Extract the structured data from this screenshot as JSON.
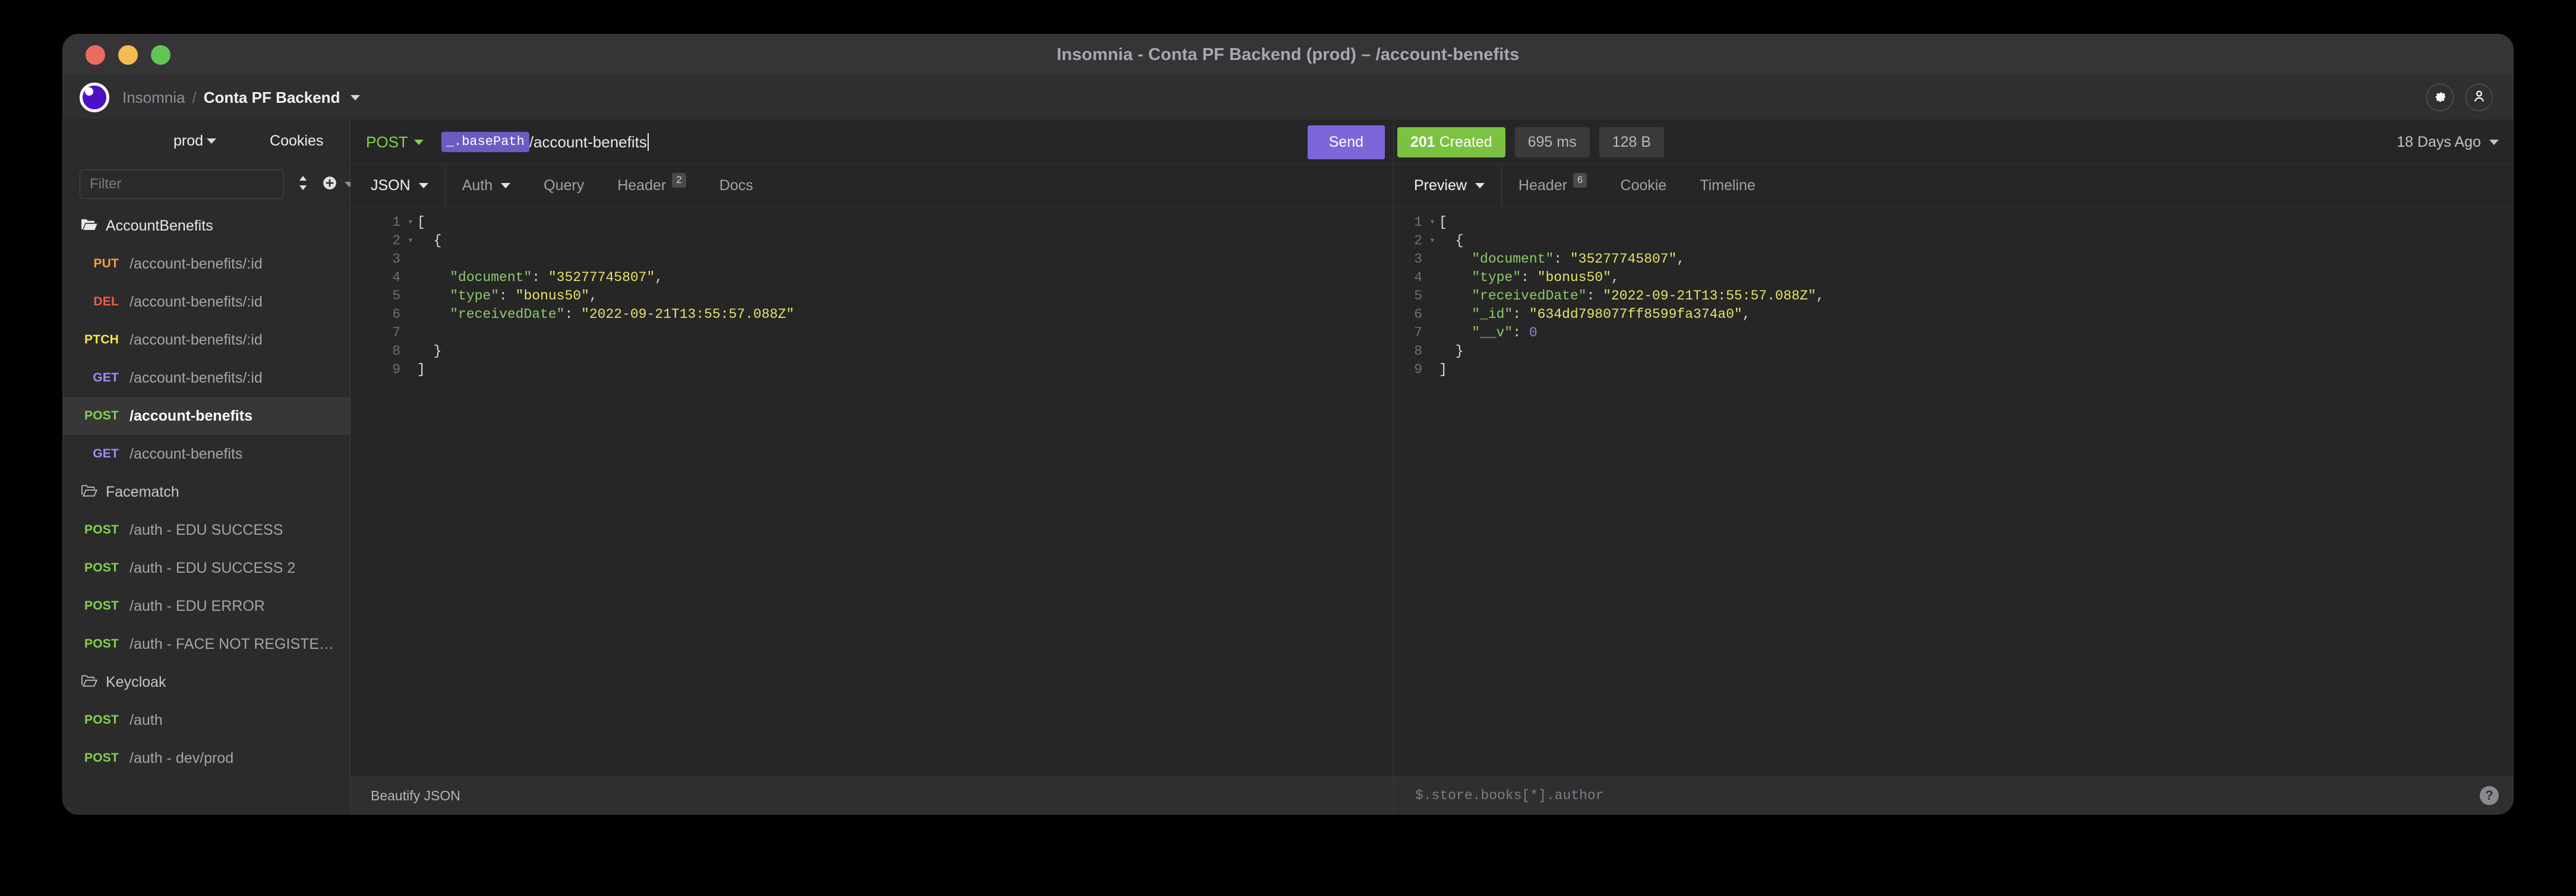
{
  "window": {
    "title": "Insomnia - Conta PF Backend (prod) – /account-benefits",
    "traffic_lights": [
      "close-button",
      "minimize-button",
      "maximize-button"
    ]
  },
  "header": {
    "logo_icon": "insomnia-logo-icon",
    "app_name": "Insomnia",
    "separator": "/",
    "workspace": "Conta PF Backend",
    "workspace_caret_icon": "chevron-down-icon",
    "settings_icon": "gear-icon",
    "account_icon": "user-icon"
  },
  "sidebar": {
    "environment": "prod",
    "environment_caret_icon": "chevron-down-icon",
    "cookies_label": "Cookies",
    "filter_placeholder": "Filter",
    "filter_value": "",
    "sort_icon": "sort-updown-icon",
    "add_icon": "plus-circle-icon",
    "add_caret_icon": "chevron-down-icon",
    "groups": [
      {
        "name": "AccountBenefits",
        "folder_icon": "folder-open-filled-icon",
        "expanded": true,
        "requests": [
          {
            "method": "PUT",
            "name": "/account-benefits/:id",
            "active": false
          },
          {
            "method": "DEL",
            "name": "/account-benefits/:id",
            "active": false
          },
          {
            "method": "PTCH",
            "name": "/account-benefits/:id",
            "active": false
          },
          {
            "method": "GET",
            "name": "/account-benefits/:id",
            "active": false
          },
          {
            "method": "POST",
            "name": "/account-benefits",
            "active": true
          },
          {
            "method": "GET",
            "name": "/account-benefits",
            "active": false
          }
        ]
      },
      {
        "name": "Facematch",
        "folder_icon": "folder-open-outline-icon",
        "expanded": true,
        "requests": [
          {
            "method": "POST",
            "name": "/auth - EDU SUCCESS",
            "active": false
          },
          {
            "method": "POST",
            "name": "/auth - EDU SUCCESS 2",
            "active": false
          },
          {
            "method": "POST",
            "name": "/auth - EDU ERROR",
            "active": false
          },
          {
            "method": "POST",
            "name": "/auth - FACE NOT REGISTER...",
            "active": false
          }
        ]
      },
      {
        "name": "Keycloak",
        "folder_icon": "folder-open-outline-icon",
        "expanded": true,
        "requests": [
          {
            "method": "POST",
            "name": "/auth",
            "active": false
          },
          {
            "method": "POST",
            "name": "/auth - dev/prod",
            "active": false
          }
        ]
      }
    ]
  },
  "request": {
    "method": "POST",
    "method_caret_icon": "chevron-down-icon",
    "url_template_tag": "_.basePath",
    "url_path": "/account-benefits",
    "send_label": "Send",
    "tabs": [
      {
        "label": "JSON",
        "has_caret": true,
        "badge": null,
        "active": true
      },
      {
        "label": "Auth",
        "has_caret": true,
        "badge": null,
        "active": false
      },
      {
        "label": "Query",
        "has_caret": false,
        "badge": null,
        "active": false
      },
      {
        "label": "Header",
        "has_caret": false,
        "badge": "2",
        "active": false
      },
      {
        "label": "Docs",
        "has_caret": false,
        "badge": null,
        "active": false
      }
    ],
    "body_lines": [
      {
        "n": "1",
        "fold": true,
        "text": "["
      },
      {
        "n": "2",
        "fold": true,
        "text": "  {"
      },
      {
        "n": "3",
        "fold": false,
        "text": ""
      },
      {
        "n": "4",
        "fold": false,
        "key": "\"document\"",
        "sep": ": ",
        "val": "\"35277745807\"",
        "tail": ",",
        "indent": "    "
      },
      {
        "n": "5",
        "fold": false,
        "key": "\"type\"",
        "sep": ": ",
        "val": "\"bonus50\"",
        "tail": ",",
        "indent": "    "
      },
      {
        "n": "6",
        "fold": false,
        "key": "\"receivedDate\"",
        "sep": ": ",
        "val": "\"2022-09-21T13:55:57.088Z\"",
        "tail": "",
        "indent": "    "
      },
      {
        "n": "7",
        "fold": false,
        "text": ""
      },
      {
        "n": "8",
        "fold": false,
        "text": "  }"
      },
      {
        "n": "9",
        "fold": false,
        "text": "]"
      }
    ],
    "footer_label": "Beautify JSON"
  },
  "response": {
    "status_code": "201",
    "status_text": "Created",
    "time": "695 ms",
    "size": "128 B",
    "history_label": "18 Days Ago",
    "history_caret_icon": "chevron-down-icon",
    "tabs": [
      {
        "label": "Preview",
        "has_caret": true,
        "badge": null,
        "active": true
      },
      {
        "label": "Header",
        "has_caret": false,
        "badge": "6",
        "active": false
      },
      {
        "label": "Cookie",
        "has_caret": false,
        "badge": null,
        "active": false
      },
      {
        "label": "Timeline",
        "has_caret": false,
        "badge": null,
        "active": false
      }
    ],
    "body_lines": [
      {
        "n": "1",
        "fold": true,
        "text": "["
      },
      {
        "n": "2",
        "fold": true,
        "text": "  {"
      },
      {
        "n": "3",
        "fold": false,
        "key": "\"document\"",
        "sep": ": ",
        "val": "\"35277745807\"",
        "tail": ",",
        "indent": "    "
      },
      {
        "n": "4",
        "fold": false,
        "key": "\"type\"",
        "sep": ": ",
        "val": "\"bonus50\"",
        "tail": ",",
        "indent": "    "
      },
      {
        "n": "5",
        "fold": false,
        "key": "\"receivedDate\"",
        "sep": ": ",
        "val": "\"2022-09-21T13:55:57.088Z\"",
        "tail": ",",
        "indent": "    "
      },
      {
        "n": "6",
        "fold": false,
        "key": "\"_id\"",
        "sep": ": ",
        "val": "\"634dd798077ff8599fa374a0\"",
        "tail": ",",
        "indent": "    "
      },
      {
        "n": "7",
        "fold": false,
        "key": "\"__v\"",
        "sep": ": ",
        "num": "0",
        "tail": "",
        "indent": "    "
      },
      {
        "n": "8",
        "fold": false,
        "text": "  }"
      },
      {
        "n": "9",
        "fold": false,
        "text": "]"
      }
    ],
    "filter_placeholder": "$.store.books[*].author",
    "filter_value": "",
    "help_icon": "question-mark-icon"
  },
  "colors": {
    "accent_purple": "#7d66d9",
    "status_green": "#7cc242",
    "method_post": "#83d24b",
    "method_get": "#a08cf5",
    "method_put": "#f1a13c",
    "method_del": "#ef5b4e",
    "method_patch": "#f2e94e",
    "template_tag": "#6b5cc4",
    "window_bg": "#2b2b2b",
    "pane_bg": "#262626",
    "titlebar_bg": "#353538"
  }
}
